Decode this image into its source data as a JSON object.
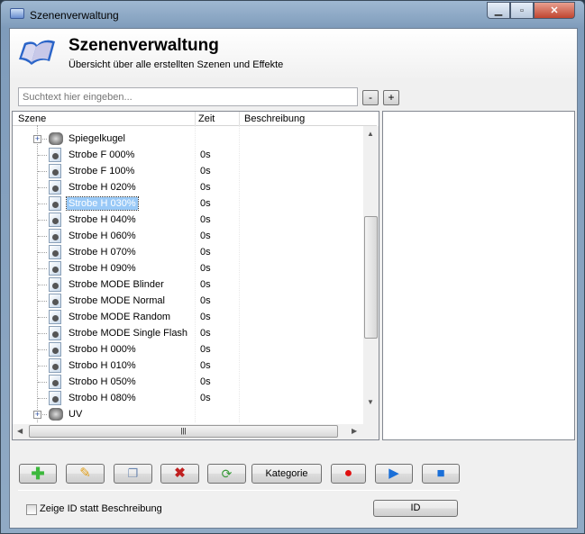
{
  "window": {
    "title": "Szenenverwaltung",
    "controls": [
      "minimize",
      "maximize",
      "close"
    ]
  },
  "header": {
    "title": "Szenenverwaltung",
    "subtitle": "Übersicht über alle erstellten Szenen und Effekte"
  },
  "search": {
    "placeholder": "Suchtext hier eingeben...",
    "value": "",
    "collapse_label": "-",
    "expand_label": "+"
  },
  "tree": {
    "columns": [
      "Szene",
      "Zeit",
      "Beschreibung"
    ],
    "rows": [
      {
        "name": "Spiegelkugel",
        "time": "",
        "type": "group",
        "expanded": false
      },
      {
        "name": "Strobe F 000%",
        "time": "0s",
        "type": "scene"
      },
      {
        "name": "Strobe F 100%",
        "time": "0s",
        "type": "scene"
      },
      {
        "name": "Strobe H 020%",
        "time": "0s",
        "type": "scene"
      },
      {
        "name": "Strobe H 030%",
        "time": "0s",
        "type": "scene",
        "selected": true
      },
      {
        "name": "Strobe H 040%",
        "time": "0s",
        "type": "scene"
      },
      {
        "name": "Strobe H 060%",
        "time": "0s",
        "type": "scene"
      },
      {
        "name": "Strobe H 070%",
        "time": "0s",
        "type": "scene"
      },
      {
        "name": "Strobe H 090%",
        "time": "0s",
        "type": "scene"
      },
      {
        "name": "Strobe MODE Blinder",
        "time": "0s",
        "type": "scene"
      },
      {
        "name": "Strobe MODE Normal",
        "time": "0s",
        "type": "scene"
      },
      {
        "name": "Strobe MODE Random",
        "time": "0s",
        "type": "scene"
      },
      {
        "name": "Strobe MODE Single Flash",
        "time": "0s",
        "type": "scene"
      },
      {
        "name": "Strobo H 000%",
        "time": "0s",
        "type": "scene"
      },
      {
        "name": "Strobo H 010%",
        "time": "0s",
        "type": "scene"
      },
      {
        "name": "Strobo H 050%",
        "time": "0s",
        "type": "scene"
      },
      {
        "name": "Strobo H 080%",
        "time": "0s",
        "type": "scene"
      },
      {
        "name": "UV",
        "time": "",
        "type": "group",
        "expanded": false
      }
    ]
  },
  "toolbar": {
    "buttons": [
      "add-icon",
      "edit-icon",
      "copy-icon",
      "delete-icon",
      "refresh-icon"
    ],
    "category_label": "Kategorie",
    "record": "record-icon",
    "play": "play-icon",
    "stop": "stop-icon"
  },
  "footer": {
    "checkbox_label": "Zeige ID statt Beschreibung",
    "checked": false,
    "id_button": "ID"
  },
  "colors": {
    "selection": "#99c9f7",
    "add": "#3cb83c",
    "delete": "#c02020",
    "record": "#e01010",
    "play": "#1a6fd8"
  }
}
